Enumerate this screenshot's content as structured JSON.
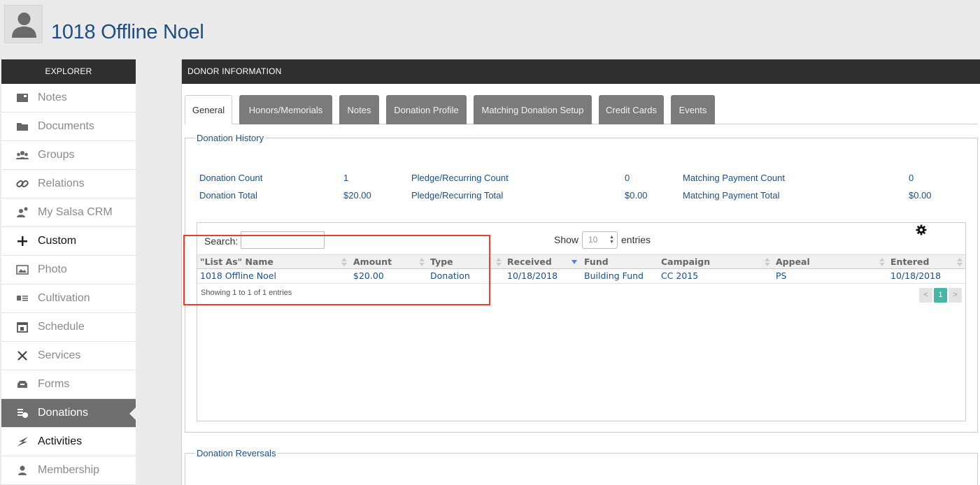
{
  "header": {
    "name": "1018 Offline Noel"
  },
  "sidebar": {
    "title": "EXPLORER",
    "items": [
      {
        "label": "Notes",
        "icon": "notes-icon"
      },
      {
        "label": "Documents",
        "icon": "folder-icon"
      },
      {
        "label": "Groups",
        "icon": "groups-icon"
      },
      {
        "label": "Relations",
        "icon": "link-icon"
      },
      {
        "label": "My Salsa CRM",
        "icon": "user-key-icon"
      },
      {
        "label": "Custom",
        "icon": "plus-icon"
      },
      {
        "label": "Photo",
        "icon": "image-icon"
      },
      {
        "label": "Cultivation",
        "icon": "list-icon"
      },
      {
        "label": "Schedule",
        "icon": "calendar-icon"
      },
      {
        "label": "Services",
        "icon": "tools-icon"
      },
      {
        "label": "Forms",
        "icon": "inbox-icon"
      },
      {
        "label": "Donations",
        "icon": "coins-icon"
      },
      {
        "label": "Activities",
        "icon": "bolt-icon"
      },
      {
        "label": "Membership",
        "icon": "member-icon"
      }
    ],
    "active": "Donations"
  },
  "panel": {
    "title": "DONOR INFORMATION"
  },
  "tabs": [
    {
      "label": "General"
    },
    {
      "label": "Honors/Memorials"
    },
    {
      "label": "Notes"
    },
    {
      "label": "Donation Profile"
    },
    {
      "label": "Matching Donation Setup"
    },
    {
      "label": "Credit Cards"
    },
    {
      "label": "Events"
    }
  ],
  "donation_history": {
    "legend": "Donation History",
    "donation_count_label": "Donation Count",
    "donation_count": "1",
    "donation_total_label": "Donation Total",
    "donation_total": "$20.00",
    "pledge_count_label": "Pledge/Recurring Count",
    "pledge_count": "0",
    "pledge_total_label": "Pledge/Recurring Total",
    "pledge_total": "$0.00",
    "matching_count_label": "Matching Payment Count",
    "matching_count": "0",
    "matching_total_label": "Matching Payment Total",
    "matching_total": "$0.00"
  },
  "table": {
    "search_label": "Search:",
    "search_value": "",
    "show_label": "Show",
    "show_value": "10",
    "entries_label": "entries",
    "columns": [
      "\"List As\" Name",
      "Amount",
      "Type",
      "Received",
      "Fund",
      "Campaign",
      "Appeal",
      "Entered"
    ],
    "rows": [
      [
        "1018 Offline Noel",
        "$20.00",
        "Donation",
        "10/18/2018",
        "Building Fund",
        "CC 2015",
        "PS",
        "10/18/2018"
      ]
    ],
    "info": "Showing 1 to 1 of 1 entries",
    "pager": {
      "prev": "<",
      "current": "1",
      "next": ">"
    }
  },
  "donation_reversals": {
    "legend": "Donation Reversals"
  },
  "colors": {
    "accent": "#1d4f86",
    "highlight": "#e8402a",
    "pager_active": "#45b7a6"
  }
}
